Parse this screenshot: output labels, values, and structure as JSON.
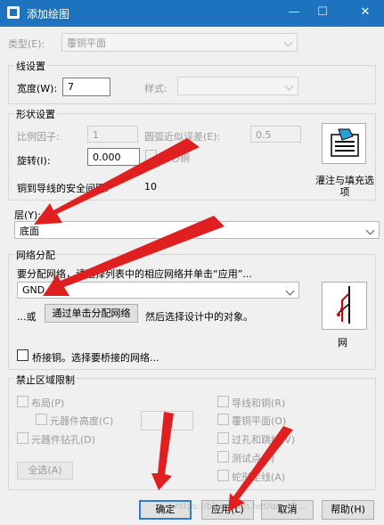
{
  "window": {
    "title": "添加绘图",
    "controls": {
      "minimize": "—",
      "maximize": "☐",
      "close": "✕"
    }
  },
  "type": {
    "label": "类型(E):",
    "value": "覆铜平面"
  },
  "line_settings": {
    "group_title": "线设置",
    "width_label": "宽度(W):",
    "width_value": "7",
    "style_label": "样式:",
    "style_value": ""
  },
  "shape_settings": {
    "group_title": "形状设置",
    "scale_label": "比例因子:",
    "scale_value": "1",
    "arc_error_label": "圆弧近似误差(E):",
    "arc_error_value": "0.5",
    "rotate_label": "旋转(I):",
    "rotate_value": "0.000",
    "solid_copper_label": "实心铜",
    "clearance_label": "铜到导线的安全间距:",
    "clearance_value": "10",
    "flood_button_label": "灌注与填充选项"
  },
  "layer": {
    "label": "层(Y):",
    "value": "底面"
  },
  "net_assign": {
    "group_title": "网络分配",
    "instruction": "要分配网络，请选择列表中的相应网络并单击“应用”...",
    "net_value": "GND",
    "or_text": "...或",
    "assign_by_click_button": "通过单击分配网络",
    "then_text": "然后选择设计中的对象。",
    "net_button_label": "网",
    "bridge_copper_label": "桥接铜。选择要桥接的网络..."
  },
  "keepout": {
    "group_title": "禁止区域限制",
    "layout_label": "布局(P)",
    "component_height_label": "元器件高度(C)",
    "component_drill_label": "元器件钻孔(D)",
    "select_all_label": "全选(A)",
    "traces_copper_label": "导线和铜(R)",
    "copper_plane_label": "覆铜平面(O)",
    "vias_jumpers_label": "过孔和跳线(V)",
    "testpoints_label": "测试点(T)",
    "serpentine_label": "蛇形走线(A)"
  },
  "buttons": {
    "ok": "确定",
    "apply": "应用(L)",
    "cancel": "取消",
    "help": "帮助(H)"
  },
  "watermark": "https://blog.csdn.net/qq_45..."
}
